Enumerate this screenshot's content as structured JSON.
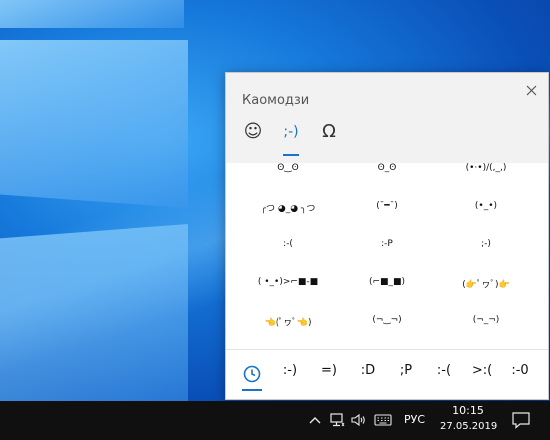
{
  "panel": {
    "title": "Каомодзи",
    "tabs": [
      {
        "label": "☺",
        "icon": "smiley-icon"
      },
      {
        "label": ";-)",
        "icon": "kaomoji-icon"
      },
      {
        "label": "Ω",
        "icon": "omega-icon"
      }
    ],
    "rows": [
      [
        "ʘ‿ʘ",
        "ʘ_ʘ",
        "(•·•)/(,_,)"
      ],
      [
        "╭つ ◕_◕ ╮つ",
        "(¯━¯)",
        "(•_•)"
      ],
      [
        ":-(",
        ":-P",
        ";-)"
      ],
      [
        "( •_•)>⌐■-■",
        "(⌐■_■)",
        "(👉ﾟヮﾟ)👉"
      ],
      [
        "👈(ﾟヮﾟ👈)",
        "(¬‿¬)",
        "(¬_¬)"
      ]
    ],
    "recent": [
      ":-)",
      "=)",
      ":D",
      ";P",
      ":-(",
      ">:(",
      ":-0"
    ]
  },
  "taskbar": {
    "language": "РУС",
    "time": "10:15",
    "date": "27.05.2019"
  },
  "colors": {
    "accent": "#1a73c6",
    "taskbar": "#101010",
    "panel_header": "#f2f2f2"
  }
}
